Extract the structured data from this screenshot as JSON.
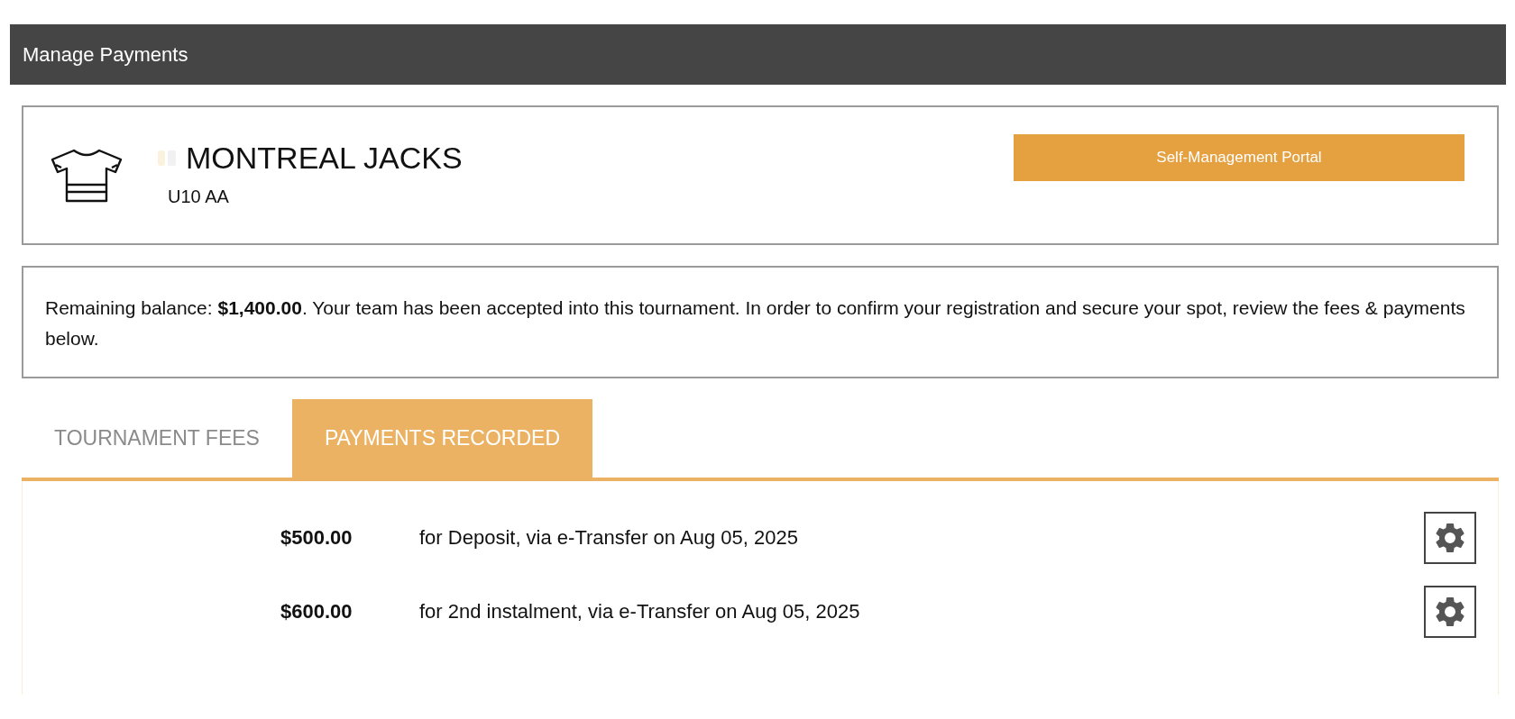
{
  "header": {
    "title": "Manage Payments"
  },
  "team": {
    "name": "MONTREAL JACKS",
    "division": "U10 AA",
    "portal_button": "Self-Management Portal"
  },
  "notice": {
    "text": "Remaining balance: **$1,400.00**. Your team has been accepted into this tournament. In order to confirm your registration and secure your spot, review the fees & payments below."
  },
  "tabs": [
    {
      "label": "TOURNAMENT FEES",
      "selected": false
    },
    {
      "label": "PAYMENTS RECORDED",
      "selected": true
    }
  ],
  "payments": [
    {
      "amount": "$500.00",
      "description": "for Deposit, via e-Transfer on Aug 05, 2025"
    },
    {
      "amount": "$600.00",
      "description": "for 2nd instalment, via e-Transfer on Aug 05, 2025"
    }
  ]
}
